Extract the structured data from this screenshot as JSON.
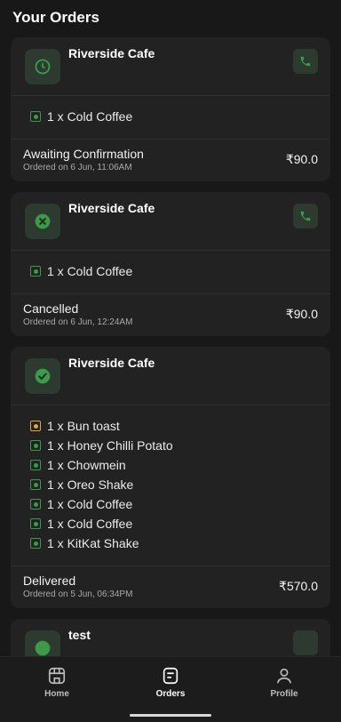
{
  "header": {
    "title": "Your Orders"
  },
  "orders": [
    {
      "cafe": "Riverside Cafe",
      "status_icon": "clock-icon",
      "has_call": true,
      "items": [
        {
          "label": "1 x Cold Coffee",
          "type": "veg"
        }
      ],
      "status": "Awaiting Confirmation",
      "date": "Ordered on 6 Jun, 11:06AM",
      "amount": "₹90.0"
    },
    {
      "cafe": "Riverside Cafe",
      "status_icon": "x-circle-icon",
      "has_call": true,
      "items": [
        {
          "label": "1 x Cold Coffee",
          "type": "veg"
        }
      ],
      "status": "Cancelled",
      "date": "Ordered on 6 Jun, 12:24AM",
      "amount": "₹90.0"
    },
    {
      "cafe": "Riverside Cafe",
      "status_icon": "check-circle-icon",
      "has_call": false,
      "items": [
        {
          "label": "1 x Bun toast",
          "type": "nonveg"
        },
        {
          "label": "1 x Honey Chilli Potato",
          "type": "veg"
        },
        {
          "label": "1 x Chowmein",
          "type": "veg"
        },
        {
          "label": "1 x Oreo Shake",
          "type": "veg"
        },
        {
          "label": "1 x Cold Coffee",
          "type": "veg"
        },
        {
          "label": "1 x Cold Coffee",
          "type": "veg"
        },
        {
          "label": "1 x KitKat Shake",
          "type": "veg"
        }
      ],
      "status": "Delivered",
      "date": "Ordered on 5 Jun, 06:34PM",
      "amount": "₹570.0"
    },
    {
      "cafe": "test",
      "status_icon": "check-circle-icon",
      "has_call": true,
      "items": [],
      "status": "",
      "date": "",
      "amount": ""
    }
  ],
  "nav": {
    "home": "Home",
    "orders": "Orders",
    "profile": "Profile"
  },
  "colors": {
    "background": "#181818",
    "card": "#222222",
    "accent_green": "#3c9a4a",
    "nonveg_orange": "#e0a63a"
  }
}
